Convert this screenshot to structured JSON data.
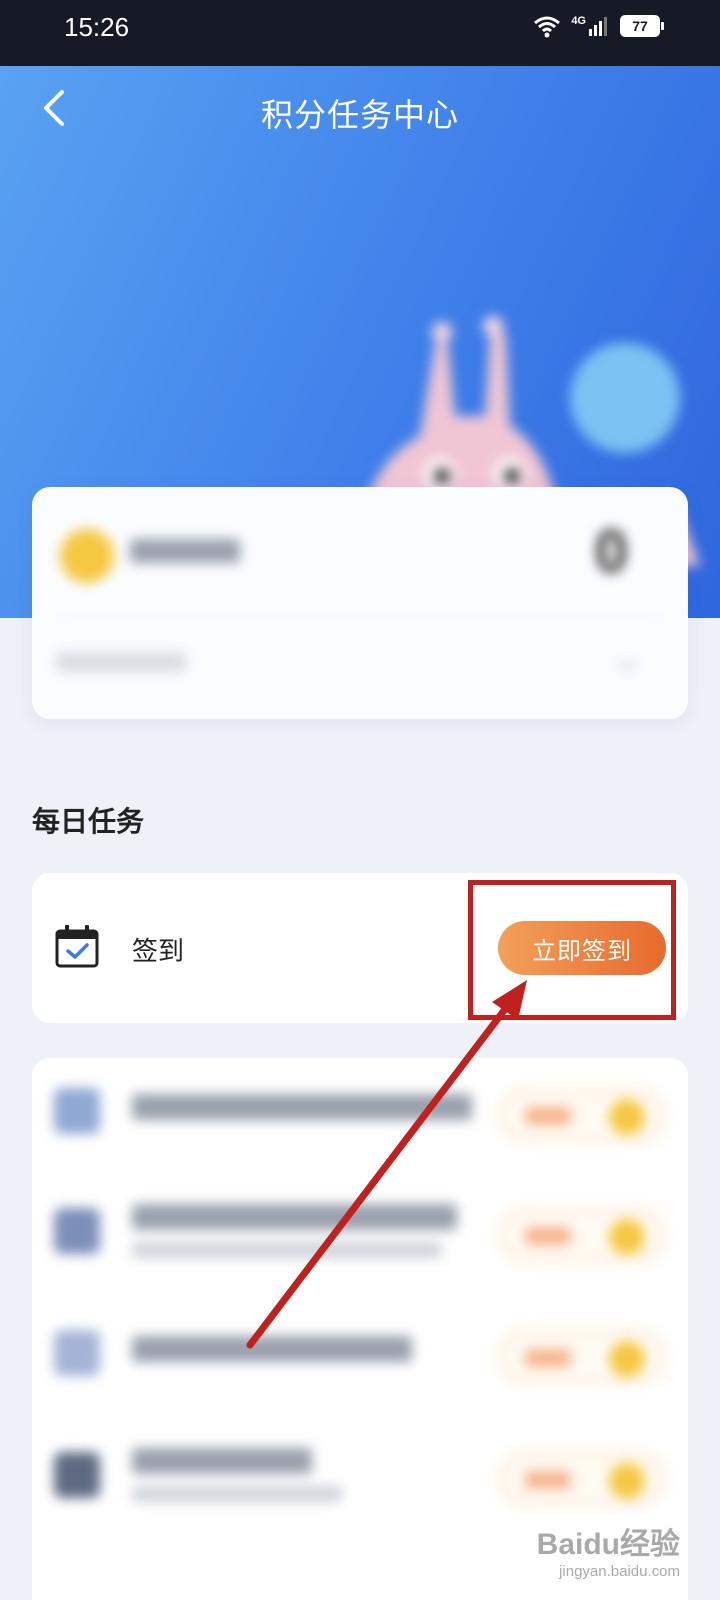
{
  "status_bar": {
    "time": "15:26",
    "network": "4G",
    "battery": "77"
  },
  "header": {
    "title": "积分任务中心"
  },
  "points_card": {
    "value": "0"
  },
  "daily_tasks": {
    "section_title": "每日任务",
    "checkin": {
      "label": "签到",
      "button_label": "立即签到"
    }
  },
  "watermark": {
    "main": "Baidu经验",
    "sub": "jingyan.baidu.com"
  },
  "colors": {
    "header_gradient_start": "#5aa2f2",
    "header_gradient_end": "#2f66dd",
    "button_gradient_start": "#f2a05a",
    "button_gradient_end": "#e86a2d",
    "highlight": "#c0201e"
  }
}
